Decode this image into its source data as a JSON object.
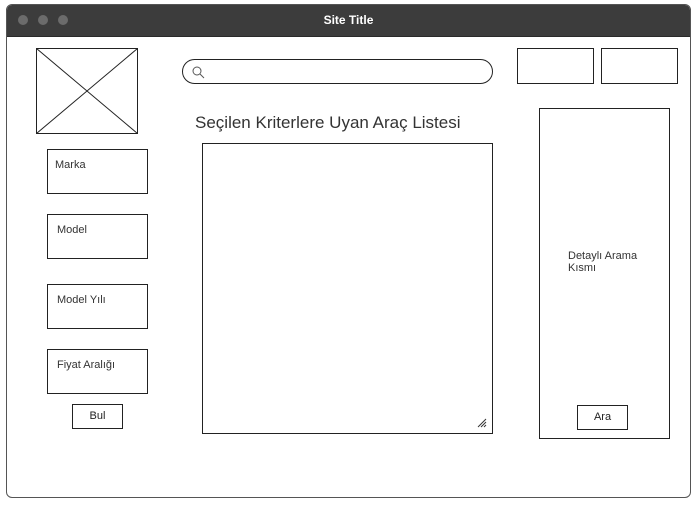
{
  "window": {
    "title": "Site Title"
  },
  "search": {
    "placeholder": ""
  },
  "main": {
    "heading": "Seçilen Kriterlere Uyan Araç Listesi"
  },
  "sidebar": {
    "filters": [
      {
        "label": "Marka"
      },
      {
        "label": "Model"
      },
      {
        "label": "Model Yılı"
      },
      {
        "label": "Fiyat Aralığı"
      }
    ],
    "find_button": "Bul"
  },
  "detail_panel": {
    "label": "Detaylı Arama Kısmı",
    "search_button": "Ara"
  }
}
